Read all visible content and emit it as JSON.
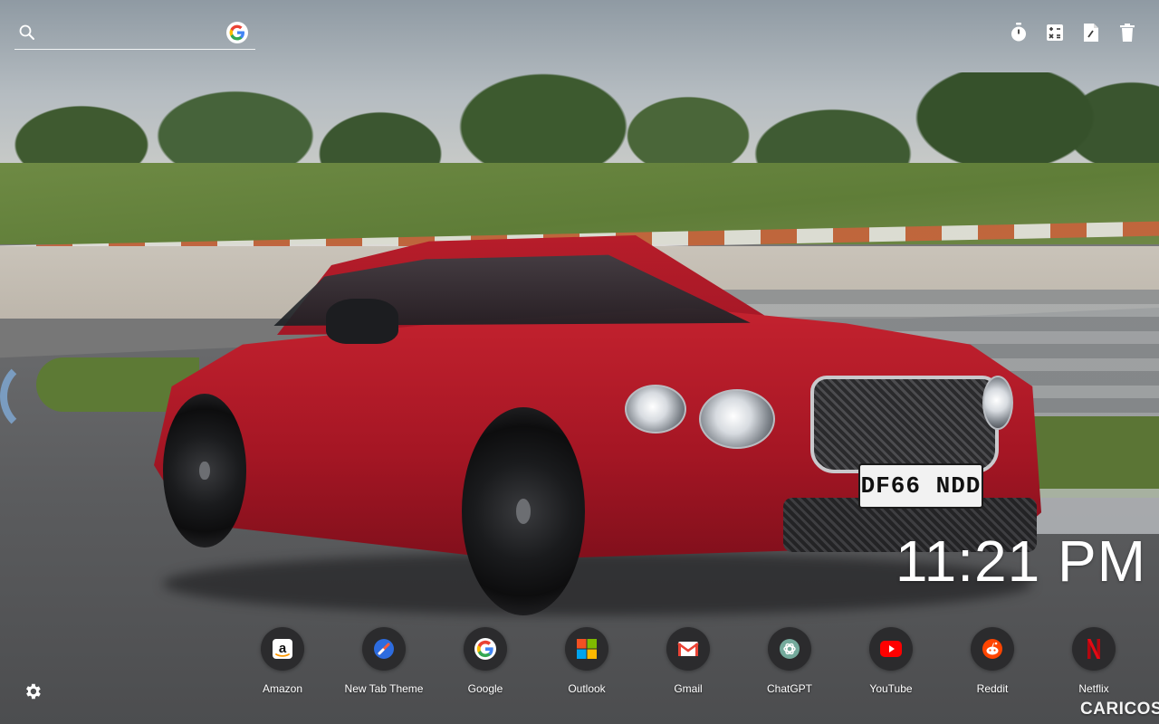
{
  "search": {
    "placeholder": "",
    "engine_icon": "google-g-icon"
  },
  "toolbar": {
    "items": [
      {
        "icon": "stopwatch-icon"
      },
      {
        "icon": "calculator-icon"
      },
      {
        "icon": "document-pen-icon"
      },
      {
        "icon": "trash-icon"
      }
    ]
  },
  "clock": {
    "time": "11:21 PM"
  },
  "car": {
    "plate": "DF66 NDD"
  },
  "shortcuts": [
    {
      "label": "Amazon",
      "icon": "amazon-icon",
      "color": "#ffffff"
    },
    {
      "label": "New Tab Theme",
      "icon": "new-tab-theme-icon",
      "color": "#2d6cdf"
    },
    {
      "label": "Google",
      "icon": "google-icon",
      "color": "#ffffff"
    },
    {
      "label": "Outlook",
      "icon": "microsoft-icon",
      "color": "#f25022"
    },
    {
      "label": "Gmail",
      "icon": "gmail-icon",
      "color": "#ea4335"
    },
    {
      "label": "ChatGPT",
      "icon": "chatgpt-icon",
      "color": "#74aa9c"
    },
    {
      "label": "YouTube",
      "icon": "youtube-icon",
      "color": "#ff0000"
    },
    {
      "label": "Reddit",
      "icon": "reddit-icon",
      "color": "#ff4500"
    },
    {
      "label": "Netflix",
      "icon": "netflix-icon",
      "color": "#e50914"
    }
  ],
  "settings": {
    "icon": "gear-icon"
  },
  "watermark": {
    "text": "CARICOS"
  }
}
